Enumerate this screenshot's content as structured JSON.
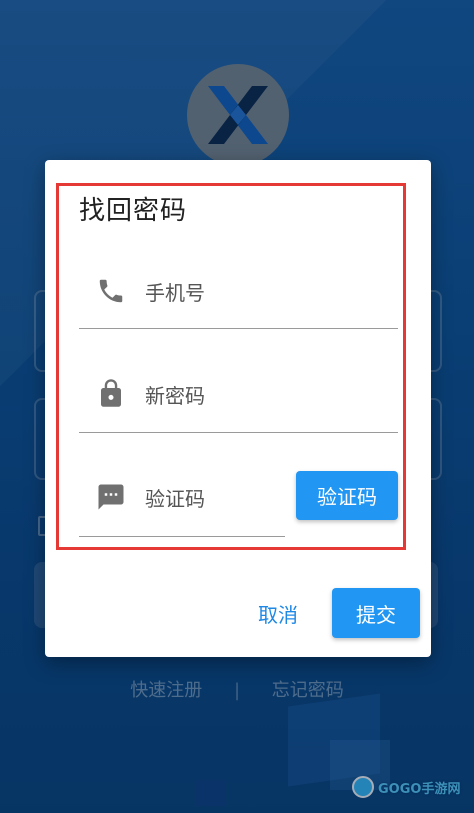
{
  "dialog": {
    "title": "找回密码",
    "fields": [
      {
        "label": "手机号",
        "icon": "phone-icon"
      },
      {
        "label": "新密码",
        "icon": "lock-icon"
      },
      {
        "label": "验证码",
        "icon": "message-icon"
      }
    ],
    "verify_button": "验证码",
    "cancel_button": "取消",
    "submit_button": "提交"
  },
  "background": {
    "links": [
      "快速注册",
      "忘记密码"
    ],
    "separator": "|",
    "watermark": "GOGO手游网"
  },
  "colors": {
    "primary": "#2196f3",
    "highlight": "#e53935",
    "background": "#0d4f92"
  }
}
